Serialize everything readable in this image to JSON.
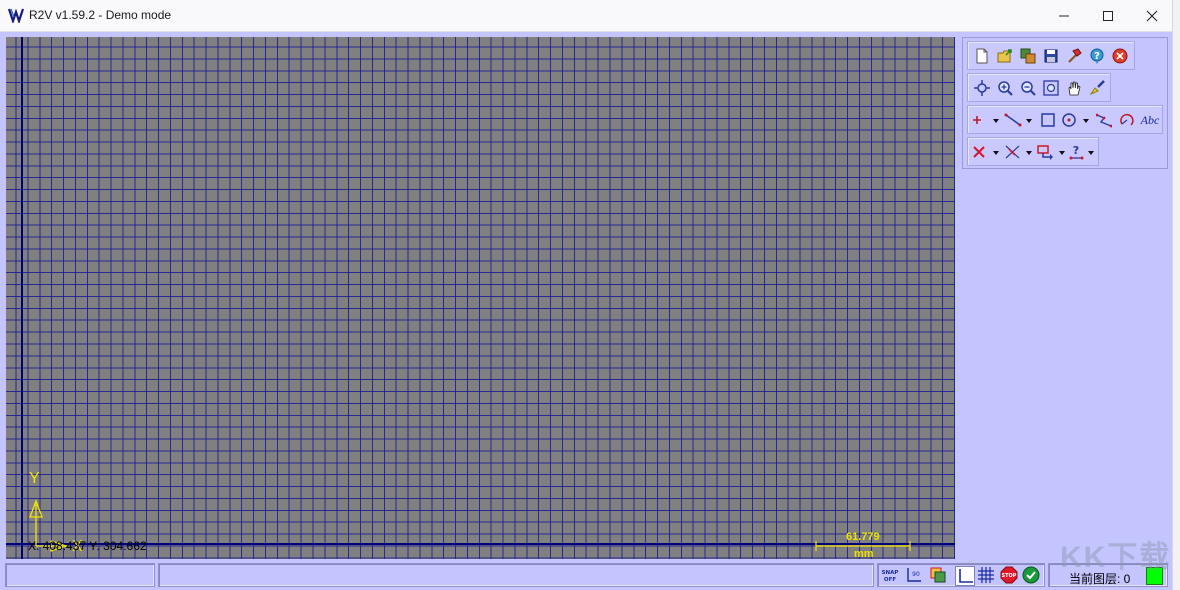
{
  "window": {
    "title": "R2V v1.59.2 - Demo mode",
    "controls": [
      "minimize",
      "maximize",
      "close"
    ]
  },
  "colors": {
    "client_bg": "#c4c4ff",
    "canvas_bg": "#808080",
    "grid": "#1a1a96",
    "axis": "#00007a",
    "overlay_yellow": "#f0e400",
    "layer_indicator": "#00ff00"
  },
  "canvas": {
    "y_axis_label": "Y",
    "x_axis_label": "X",
    "scale_value": "61.779",
    "scale_unit": "mm"
  },
  "toolbar": {
    "rows": [
      [
        "new-file-icon",
        "open-folder-icon",
        "import-icon",
        "save-icon",
        "hammer-icon",
        "help-icon",
        "exit-icon"
      ],
      [
        "center-icon",
        "zoom-in-icon",
        "zoom-out-icon",
        "zoom-fit-icon",
        "pan-hand-icon",
        "brush-icon"
      ],
      [
        "point-icon",
        "line-icon",
        "rectangle-icon",
        "circle-icon",
        "polyline-icon",
        "arc-icon",
        "text-icon"
      ],
      [
        "delete-icon",
        "trim-icon",
        "move-icon",
        "query-icon"
      ]
    ],
    "text_tool_label": "Abc"
  },
  "statusbar": {
    "coordinates": "X: 408.437 Y: 304.662",
    "message": "",
    "snap_label": "SNAP OFF",
    "stop_label": "STOP",
    "layer_label": "当前图层: 0"
  },
  "watermark": "KK下载"
}
